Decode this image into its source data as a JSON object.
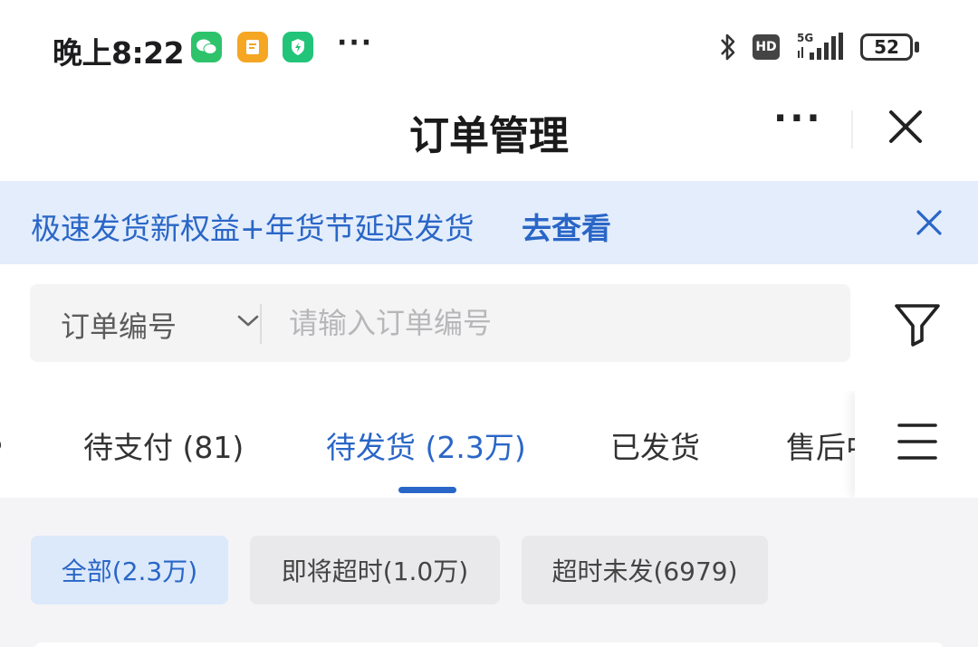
{
  "status_bar": {
    "time": "晚上8:22",
    "more": "···",
    "hd": "HD",
    "network": "5G",
    "battery": "52"
  },
  "header": {
    "title": "订单管理",
    "more": "···"
  },
  "banner": {
    "text": "极速发货新权益+年货节延迟发货",
    "link": "去查看"
  },
  "search": {
    "type_label": "订单编号",
    "placeholder": "请输入订单编号",
    "value": ""
  },
  "tabs": [
    {
      "label": "待支付 (81)",
      "active": false
    },
    {
      "label": "待发货 (2.3万)",
      "active": true
    },
    {
      "label": "已发货",
      "active": false
    },
    {
      "label": "售后中",
      "active": false
    }
  ],
  "chips": [
    {
      "label": "全部(2.3万)",
      "active": true
    },
    {
      "label": "即将超时(1.0万)",
      "active": false
    },
    {
      "label": "超时未发(6979)",
      "active": false
    }
  ],
  "colors": {
    "accent": "#2a66c7",
    "banner_bg": "#e3edfb",
    "chip_active_bg": "#dce9fb"
  }
}
